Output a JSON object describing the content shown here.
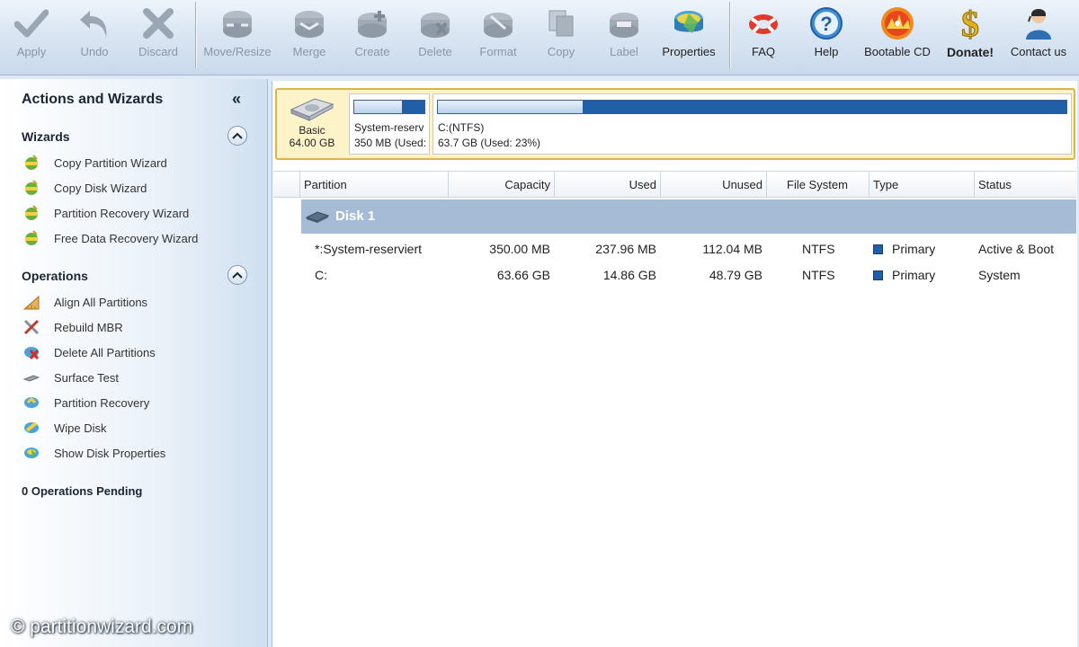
{
  "toolbar": {
    "apply": "Apply",
    "undo": "Undo",
    "discard": "Discard",
    "move_resize": "Move/Resize",
    "merge": "Merge",
    "create": "Create",
    "delete": "Delete",
    "format": "Format",
    "copy": "Copy",
    "label": "Label",
    "properties": "Properties",
    "faq": "FAQ",
    "help": "Help",
    "bootable_cd": "Bootable CD",
    "donate": "Donate!",
    "contact": "Contact us"
  },
  "sidebar": {
    "title": "Actions and Wizards",
    "collapse_glyph": "«",
    "wizards": {
      "heading": "Wizards",
      "items": [
        {
          "label": "Copy Partition Wizard"
        },
        {
          "label": "Copy Disk Wizard"
        },
        {
          "label": "Partition Recovery Wizard"
        },
        {
          "label": "Free Data Recovery Wizard"
        }
      ]
    },
    "operations": {
      "heading": "Operations",
      "items": [
        {
          "label": "Align All Partitions"
        },
        {
          "label": "Rebuild MBR"
        },
        {
          "label": "Delete All Partitions"
        },
        {
          "label": "Surface Test"
        },
        {
          "label": "Partition Recovery"
        },
        {
          "label": "Wipe Disk"
        },
        {
          "label": "Show Disk Properties"
        }
      ]
    },
    "pending": "0 Operations Pending"
  },
  "diskmap": {
    "basic_label": "Basic",
    "basic_size": "64.00 GB",
    "partitions": [
      {
        "name": "System-reserv",
        "size": "350 MB (Used:",
        "used_fraction": 0.68
      },
      {
        "name": "C:(NTFS)",
        "size": "63.7 GB (Used: 23%)",
        "used_fraction": 0.23
      }
    ]
  },
  "table": {
    "headers": {
      "partition": "Partition",
      "capacity": "Capacity",
      "used": "Used",
      "unused": "Unused",
      "filesystem": "File System",
      "type": "Type",
      "status": "Status"
    },
    "disk_label": "Disk 1",
    "rows": [
      {
        "partition": "*:System-reserviert",
        "capacity": "350.00 MB",
        "used": "237.96 MB",
        "unused": "112.04 MB",
        "filesystem": "NTFS",
        "type": "Primary",
        "status": "Active & Boot"
      },
      {
        "partition": "C:",
        "capacity": "63.66 GB",
        "used": "14.86 GB",
        "unused": "48.79 GB",
        "filesystem": "NTFS",
        "type": "Primary",
        "status": "System"
      }
    ]
  },
  "watermark": "© partitionwizard.com",
  "colors": {
    "accent": "#1f5fa8",
    "disk_row": "#a6bcd6",
    "diskmap_border": "#d9b64a",
    "diskmap_bg": "#fdf3c8"
  }
}
